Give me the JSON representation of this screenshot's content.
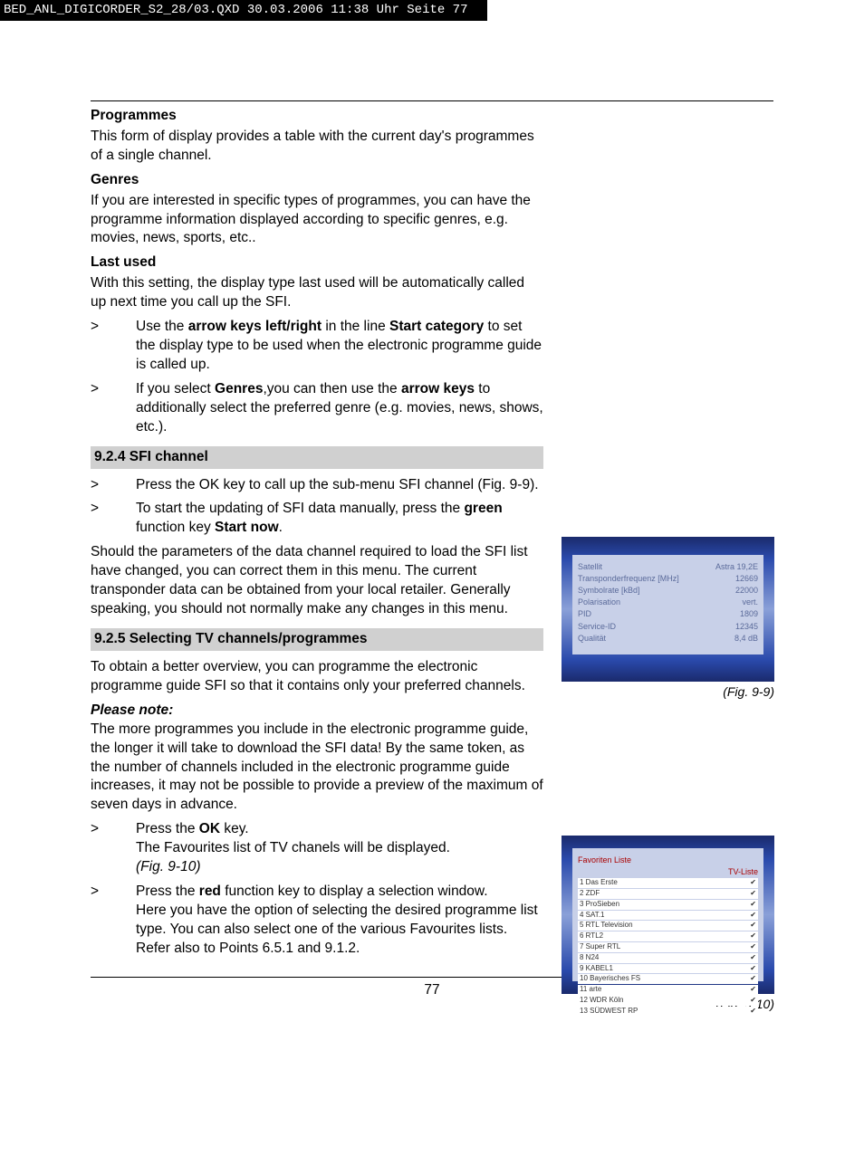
{
  "top_meta": "BED_ANL_DIGICORDER_S2_28/03.QXD  30.03.2006  11:38 Uhr  Seite 77",
  "page_number": "77",
  "sec_programmes": {
    "title": "Programmes",
    "body": "This form of display provides a table with the current day's programmes of a single channel."
  },
  "sec_genres": {
    "title": "Genres",
    "body": "If you are interested in specific types of programmes, you can have the programme information displayed according to specific genres, e.g. movies, news, sports, etc.."
  },
  "sec_lastused": {
    "title": "Last used",
    "body": "With this setting, the display type last used will be automatically called up next time you call up the SFI."
  },
  "bullet1": {
    "mark": ">",
    "p1a": "Use the ",
    "p1b": "arrow keys left/right",
    "p1c": " in the line ",
    "p1d": "Start category",
    "p1e": " to set the display type to be used when the electronic programme guide is called up."
  },
  "bullet2": {
    "mark": ">",
    "p1a": "If you select ",
    "p1b": "Genres",
    "p1c": ",you can then use the ",
    "p1d": "arrow keys",
    "p1e": " to additionally select the preferred genre (e.g. movies, news, shows, etc.)."
  },
  "head_924": "9.2.4 SFI channel",
  "bullet3": {
    "mark": ">",
    "text": "Press the OK key to call up the sub-menu SFI channel (Fig. 9-9)."
  },
  "bullet4": {
    "mark": ">",
    "p1a": "To start the updating of SFI data manually, press the ",
    "p1b": "green",
    "p1c": " function key ",
    "p1d": "Start now",
    "p1e": "."
  },
  "para_should": "Should the parameters of the data channel required to load the SFI list have changed, you can correct them in this menu. The current transponder data can be obtained from your local retailer. Generally speaking, you should not normally make any changes in this menu.",
  "head_925": "9.2.5 Selecting TV channels/programmes",
  "para_obtain": "To obtain a better overview,  you can programme the electronic programme guide SFI so that it contains only your preferred channels.",
  "please_note": "Please note:",
  "para_more": "The more programmes you include in the electronic programme guide, the longer it will take to download the SFI data! By the same token, as the number of channels included in the electronic programme guide increases, it may not be possible to provide a preview of the maximum of seven days in advance.",
  "bullet5": {
    "mark": ">",
    "p1a": "Press the ",
    "p1b": "OK",
    "p1c": " key.",
    "line2": "The Favourites list of TV chanels will be displayed.",
    "line3": "(Fig. 9-10)"
  },
  "bullet6": {
    "mark": ">",
    "p1a": "Press the ",
    "p1b": "red",
    "p1c": " function key to display a selection window.",
    "line2": "Here you have the option of selecting the desired programme list type. You can also select one of the various Favourites lists. Refer also to Points 6.5.1 and 9.1.2."
  },
  "fig99": {
    "caption": "(Fig. 9-9)",
    "rows": {
      "satellite_l": "Satellit",
      "satellite_v": "Astra 19,2E",
      "trans_l": "Transponderfrequenz [MHz]",
      "trans_v": "12669",
      "sym_l": "Symbolrate [kBd]",
      "sym_v": "22000",
      "pol_l": "Polarisation",
      "pol_v": "vert.",
      "pid_l": "PID",
      "pid_v": "1809",
      "sid_l": "Service-ID",
      "sid_v": "12345",
      "qual_l": "Qualität",
      "qual_v": "8,4 dB"
    }
  },
  "fig910": {
    "caption": "(Fig. 9-10)",
    "header_l": "Favoriten Liste",
    "header_r": "TV-Liste",
    "items": [
      {
        "n": "1",
        "name": "Das Erste"
      },
      {
        "n": "2",
        "name": "ZDF"
      },
      {
        "n": "3",
        "name": "ProSieben"
      },
      {
        "n": "4",
        "name": "SAT.1"
      },
      {
        "n": "5",
        "name": "RTL Television"
      },
      {
        "n": "6",
        "name": "RTL2"
      },
      {
        "n": "7",
        "name": "Super RTL"
      },
      {
        "n": "8",
        "name": "N24"
      },
      {
        "n": "9",
        "name": "KABEL1"
      },
      {
        "n": "10",
        "name": "Bayerisches FS"
      },
      {
        "n": "11",
        "name": "arte"
      },
      {
        "n": "12",
        "name": "WDR Köln"
      },
      {
        "n": "13",
        "name": "SÜDWEST RP"
      }
    ]
  }
}
